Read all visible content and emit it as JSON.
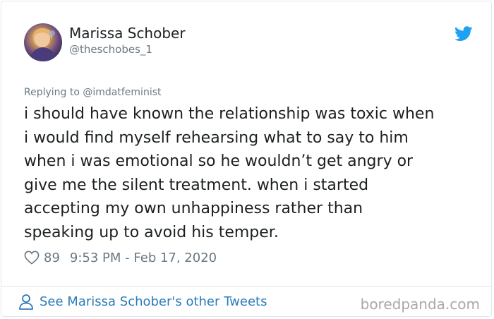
{
  "author": {
    "display_name": "Marissa Schober",
    "handle": "@theschobes_1",
    "avatar_icon": "profile-photo"
  },
  "header": {
    "platform_icon": "twitter-bird-icon",
    "brand_color": "#1da1f2"
  },
  "reply_context": {
    "prefix": "Replying to",
    "mention": "@imdatfeminist"
  },
  "tweet": {
    "lines": [
      "i should have known the relationship was toxic when",
      "i would find myself rehearsing what to say to him",
      "when i was emotional so he wouldn’t get angry or",
      "give me the silent treatment. when i started",
      "accepting my own unhappiness rather than",
      "speaking up to avoid his temper."
    ]
  },
  "meta": {
    "likes": "89",
    "timestamp": "9:53 PM - Feb 17, 2020"
  },
  "footer": {
    "link_label": "See Marissa Schober's other Tweets",
    "link_color": "#2b7bb9"
  },
  "watermark": {
    "text": "boredpanda.com"
  }
}
